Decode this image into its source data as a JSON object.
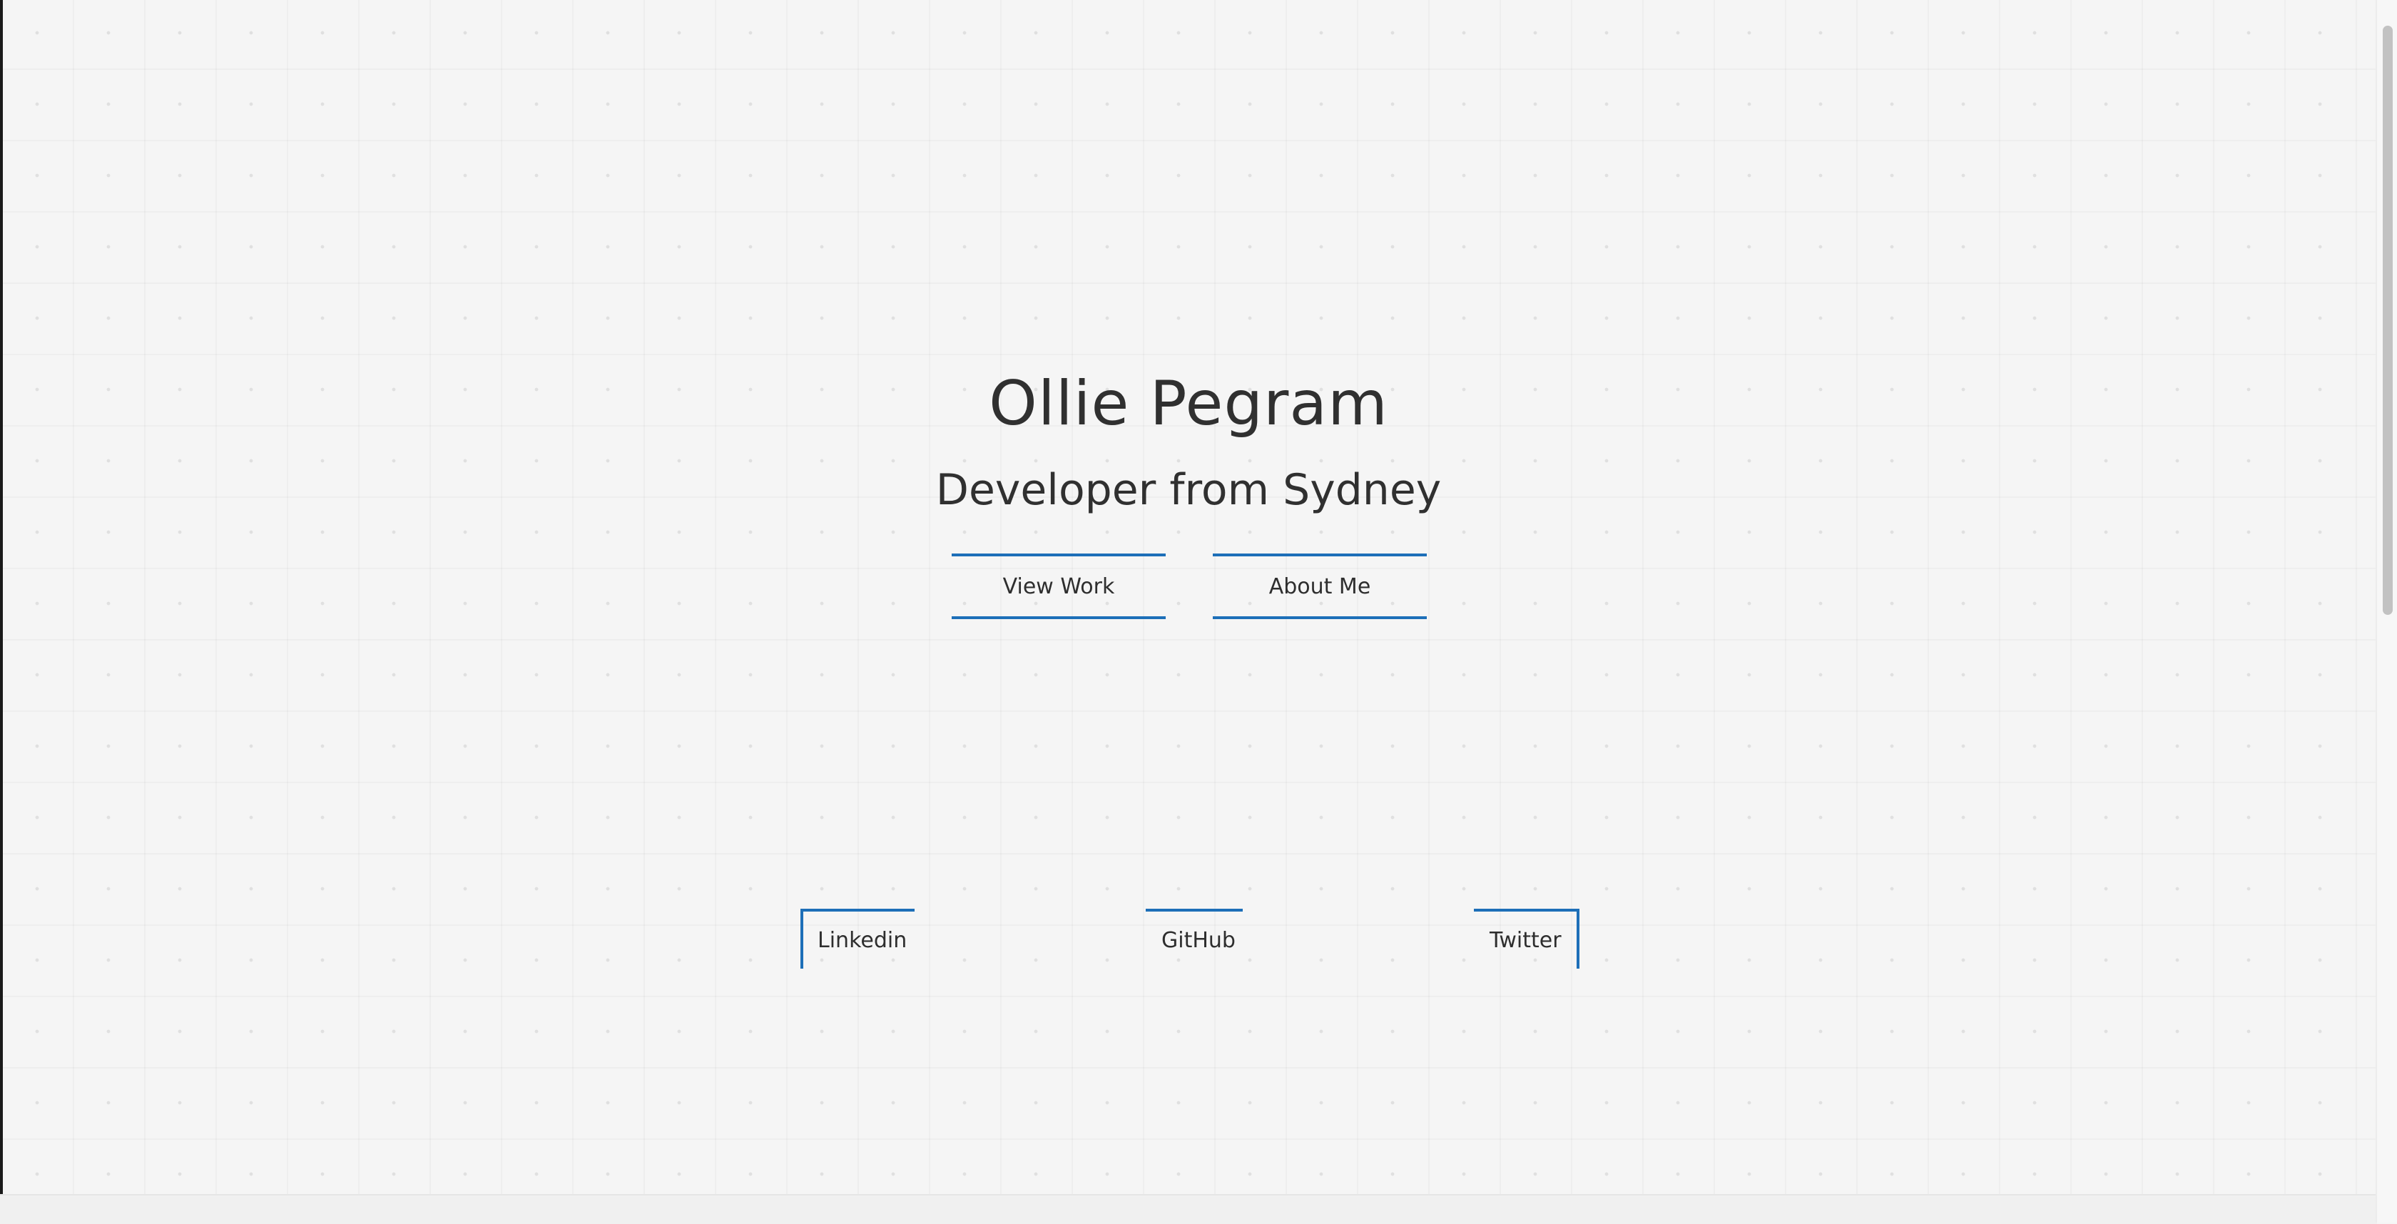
{
  "hero": {
    "name": "Ollie Pegram",
    "tagline": "Developer from Sydney"
  },
  "actions": {
    "view_work": "View Work",
    "about_me": "About Me"
  },
  "social": {
    "linkedin": "Linkedin",
    "github": "GitHub",
    "twitter": "Twitter"
  },
  "colors": {
    "background": "#f5f5f5",
    "accent": "#1d6fb8",
    "text": "#303030"
  }
}
